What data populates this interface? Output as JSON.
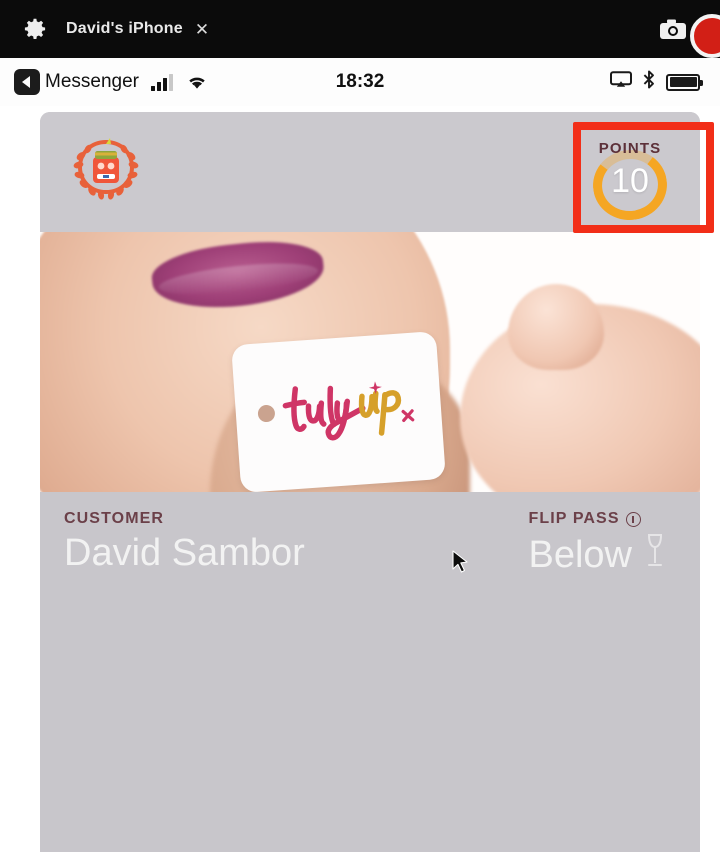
{
  "window": {
    "gear_icon": "gear-icon",
    "title": "David's iPhone",
    "close_label": "✕",
    "camera_icon": "camera-icon",
    "record_icon": "record-button"
  },
  "status_bar": {
    "back_icon": "back-chevron-icon",
    "carrier": "Messenger",
    "signal_icon": "cellular-signal-icon",
    "signal_bars_filled": 3,
    "signal_bars_total": 4,
    "wifi_icon": "wifi-icon",
    "time": "18:32",
    "airplay_icon": "airplay-icon",
    "bluetooth_icon": "bluetooth-icon",
    "battery_icon": "battery-full-icon"
  },
  "card": {
    "brand_logo_icon": "laurel-wreath-badge-icon",
    "points": {
      "label": "POINTS",
      "value": "10",
      "ring_color": "#f5a623"
    },
    "hero": {
      "tag_wordmark": "trulyVIP",
      "alt": "woman holding trulyVIP tag"
    },
    "customer": {
      "label": "CUSTOMER",
      "value": "David Sambor"
    },
    "flip_pass": {
      "label": "FLIP PASS",
      "info_icon": "info-circle-icon",
      "value": "Below",
      "glass_icon": "wine-glass-icon"
    }
  },
  "annotation": {
    "type": "highlight-rectangle",
    "color": "#f22e18",
    "target": "points-badge"
  },
  "cursor": {
    "icon": "mouse-pointer-icon"
  }
}
